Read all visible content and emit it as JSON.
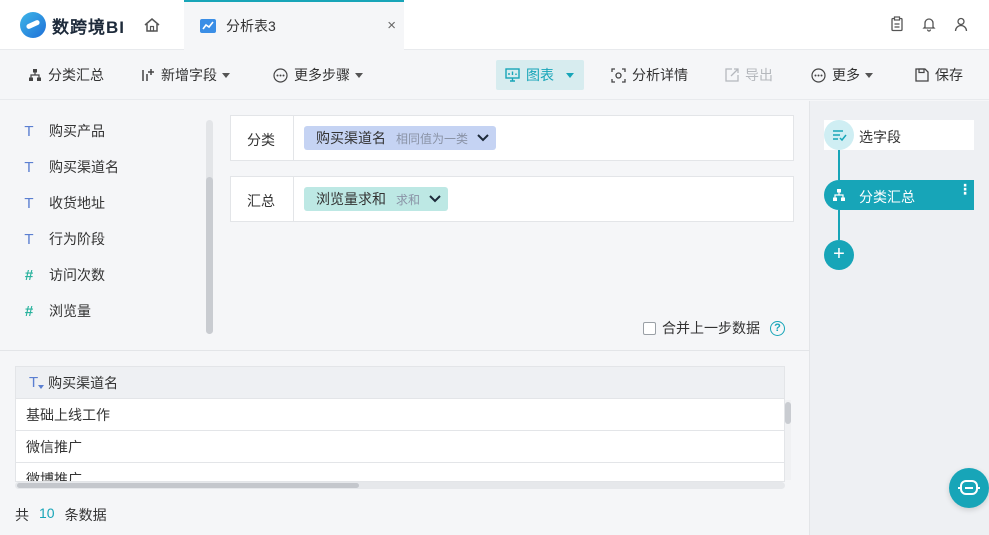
{
  "app": {
    "logo_text": "数跨境BI"
  },
  "tab": {
    "label": "分析表3",
    "close": "×"
  },
  "toolbar": {
    "group_summary": "分类汇总",
    "add_field": "新增字段",
    "more_steps": "更多步骤",
    "chart": "图表",
    "analysis_detail": "分析详情",
    "export": "导出",
    "more": "更多",
    "save": "保存"
  },
  "fields": [
    {
      "type": "T",
      "name": "购买产品"
    },
    {
      "type": "T",
      "name": "购买渠道名"
    },
    {
      "type": "T",
      "name": "收货地址"
    },
    {
      "type": "T",
      "name": "行为阶段"
    },
    {
      "type": "#",
      "name": "访问次数"
    },
    {
      "type": "#",
      "name": "浏览量"
    }
  ],
  "config": {
    "category_label": "分类",
    "category_chip": "购买渠道名",
    "category_chip_sub": "相同值为一类",
    "summary_label": "汇总",
    "summary_chip": "浏览量求和",
    "summary_chip_sub": "求和",
    "merge_label": "合并上一步数据",
    "help": "?"
  },
  "table": {
    "header_type": "T",
    "header": "购买渠道名",
    "rows": [
      "基础上线工作",
      "微信推广",
      "微博推广"
    ]
  },
  "footer": {
    "prefix": "共",
    "count": "10",
    "suffix": "条数据"
  },
  "steps": {
    "select_fields": "选字段",
    "group_summary": "分类汇总",
    "more": "⋮",
    "add": "+"
  },
  "colors": {
    "accent": "#17a5b8",
    "chip_blue": "#c5d3f3",
    "chip_green": "#bde8e4"
  }
}
